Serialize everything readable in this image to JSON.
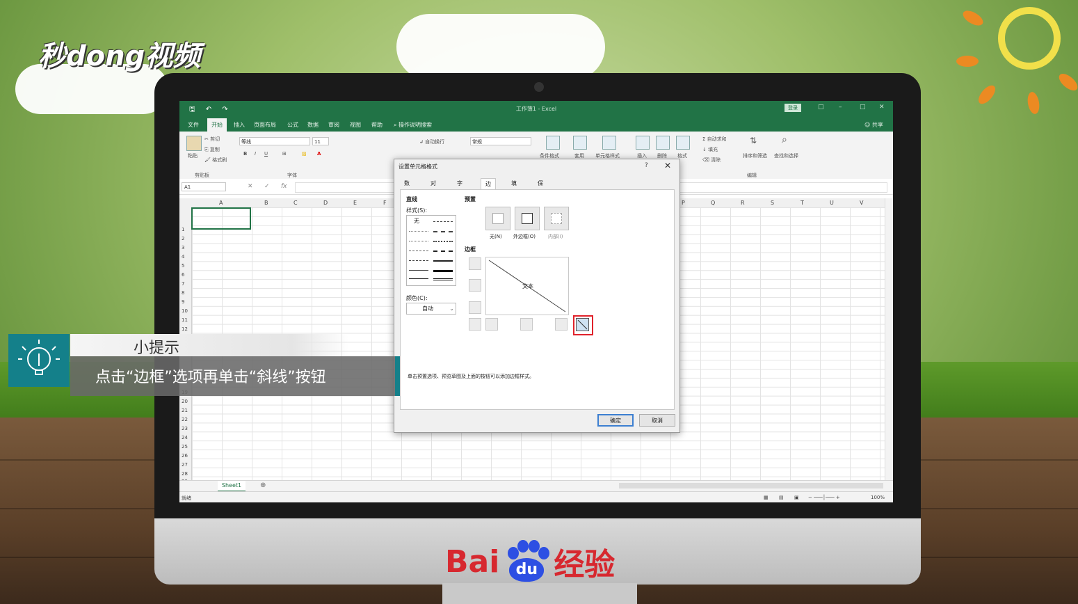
{
  "watermarks": {
    "top_logo": "秒dong视频",
    "bottom_logo_left": "Bai",
    "bottom_logo_paw": "du",
    "bottom_logo_right": "经验"
  },
  "excel": {
    "title": "工作簿1 - Excel",
    "login_label": "登录",
    "share_label": "共享",
    "menu_tabs": [
      "文件",
      "开始",
      "插入",
      "页面布局",
      "公式",
      "数据",
      "审阅",
      "视图",
      "帮助",
      "操作说明搜索"
    ],
    "ribbon": {
      "paste": "粘贴",
      "cut": "剪切",
      "copy": "复制",
      "format_painter": "格式刷",
      "clipboard_group": "剪贴板",
      "font_name": "等线",
      "font_size": "11",
      "font_group": "字体",
      "wrap_text": "自动换行",
      "number_format": "常规",
      "conditional_format": "条件格式",
      "table": "套用",
      "cell_style": "单元格样式",
      "insert": "插入",
      "delete": "删除",
      "format": "格式",
      "autosum": "自动求和",
      "fill": "填充",
      "clear": "清除",
      "sort_filter": "排序和筛选",
      "find_select": "查找和选择",
      "edit_group": "编辑"
    },
    "name_box": "A1",
    "columns_left": [
      "A",
      "B",
      "C",
      "D",
      "E",
      "F"
    ],
    "columns_right": [
      "P",
      "Q",
      "R",
      "S",
      "T",
      "U",
      "V"
    ],
    "rows": [
      "1",
      "2",
      "3",
      "4",
      "5",
      "6",
      "7",
      "8",
      "9",
      "10",
      "11",
      "12",
      "19",
      "20",
      "21",
      "22",
      "23",
      "24",
      "25",
      "26",
      "27",
      "28",
      "29"
    ],
    "sheet_tab": "Sheet1",
    "status": "就绪",
    "zoom": "100%"
  },
  "dialog": {
    "title": "设置单元格格式",
    "help": "?",
    "tabs": [
      "数字",
      "对齐",
      "字体",
      "边框",
      "填充",
      "保护"
    ],
    "active_tab": "边框",
    "line_section": "直线",
    "style_label": "样式(S):",
    "none_style": "无",
    "color_label": "颜色(C):",
    "color_value": "自动",
    "preset_section": "预置",
    "presets": [
      "无(N)",
      "外边框(O)",
      "内部(I)"
    ],
    "border_section": "边框",
    "preview_text": "文本",
    "note": "单击预置选项、预览草图及上面的按钮可以添加边框样式。",
    "ok": "确定",
    "cancel": "取消"
  },
  "tip": {
    "title": "小提示",
    "body": "点击“边框”选项再单击“斜线”按钮",
    "accent_color": "#14808a"
  }
}
